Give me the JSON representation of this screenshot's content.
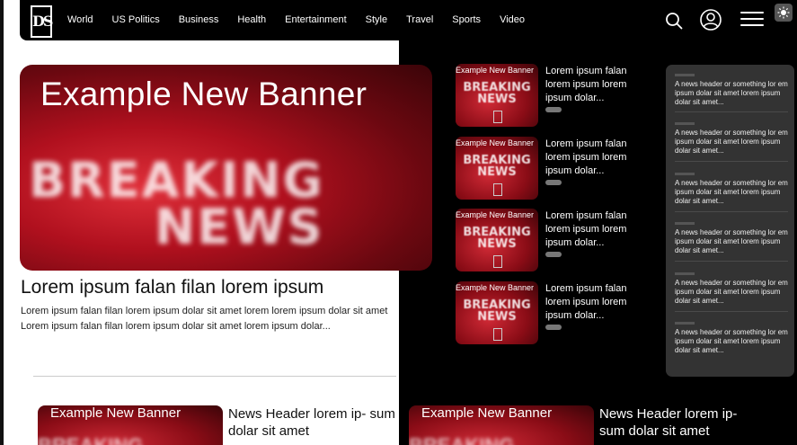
{
  "nav": {
    "logo": "DS",
    "items": [
      "World",
      "US Politics",
      "Business",
      "Health",
      "Entertainment",
      "Style",
      "Travel",
      "Sports",
      "Video"
    ]
  },
  "hero": {
    "banner_title": "Example New Banner",
    "image_text_1": "BREAKING",
    "image_text_2": "NEWS",
    "headline": "Lorem ipsum falan filan lorem ipsum",
    "body": "Lorem ipsum falan filan lorem ipsum dolar sit amet lorem lorem ipsum dolar sit amet Lorem ipsum falan filan lorem ipsum dolar sit amet lorem ipsum dolar..."
  },
  "side_list": [
    {
      "banner_title": "Example New Banner",
      "image_text": "BREAKING NEWS",
      "text": "Lorem ipsum falan lorem ipsum lorem ipsum dolar..."
    },
    {
      "banner_title": "Example New Banner",
      "image_text": "BREAKING NEWS",
      "text": "Lorem ipsum falan lorem ipsum lorem ipsum dolar..."
    },
    {
      "banner_title": "Example New Banner",
      "image_text": "BREAKING NEWS",
      "text": "Lorem ipsum falan lorem ipsum lorem ipsum dolar..."
    },
    {
      "banner_title": "Example New Banner",
      "image_text": "BREAKING NEWS",
      "text": "Lorem ipsum falan lorem ipsum lorem ipsum dolar..."
    }
  ],
  "panel": [
    {
      "text": "A news header or something lor em ipsum dolar sit amet lorem ipsum dolar sit amet..."
    },
    {
      "text": "A news header or something lor em ipsum dolar sit amet lorem ipsum dolar sit amet..."
    },
    {
      "text": "A news header or something lor em ipsum dolar sit amet lorem ipsum dolar sit amet..."
    },
    {
      "text": "A news header or something lor em ipsum dolar sit amet lorem ipsum dolar sit amet..."
    },
    {
      "text": "A news header or something lor em ipsum dolar sit amet lorem ipsum dolar sit amet..."
    },
    {
      "text": "A news header or something lor em ipsum dolar sit amet lorem ipsum dolar sit amet..."
    }
  ],
  "bottom_cards": [
    {
      "banner_title": "Example New Banner",
      "image_text": "BREAKING",
      "headline": "News Header lorem ip- sum dolar sit amet"
    },
    {
      "banner_title": "Example New Banner",
      "image_text": "BREAKING",
      "headline": "News Header lorem ip- sum dolar sit amet"
    }
  ],
  "colors": {
    "accent": "#b0101e",
    "dark_bg": "#000000",
    "panel_bg": "#333333"
  }
}
